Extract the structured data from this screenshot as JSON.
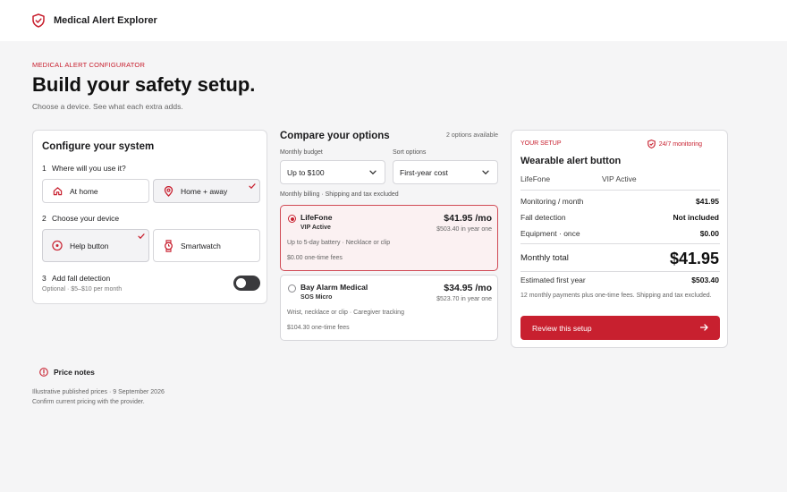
{
  "header": {
    "app_title": "Medical Alert Explorer",
    "logo_icon": "shield-check-icon"
  },
  "hero": {
    "eyebrow": "MEDICAL ALERT CONFIGURATOR",
    "title": "Build your safety setup.",
    "subtitle": "Choose a device. See what each extra adds."
  },
  "config": {
    "title": "Configure your system",
    "step1": {
      "num": "1",
      "question": "Where will you use it?",
      "options": [
        {
          "label": "At home",
          "icon": "home-icon",
          "selected": false
        },
        {
          "label": "Home + away",
          "icon": "location-pin-icon",
          "selected": true
        }
      ]
    },
    "step2": {
      "num": "2",
      "question": "Choose your device",
      "options": [
        {
          "label": "Help button",
          "icon": "help-button-icon",
          "selected": true
        },
        {
          "label": "Smartwatch",
          "icon": "watch-icon",
          "selected": false
        }
      ]
    },
    "step3": {
      "num": "3",
      "question": "Add fall detection",
      "hint": "Optional · $5–$10 per month",
      "enabled": false
    }
  },
  "compare": {
    "title": "Compare your options",
    "available": "2 options available",
    "budget_label": "Monthly budget",
    "budget_value": "Up to $100",
    "sort_label": "Sort options",
    "sort_value": "First-year cost",
    "billing_note": "Monthly billing · Shipping and tax excluded",
    "plans": [
      {
        "name": "LifeFone",
        "model": "VIP Active",
        "price": "$41.95 /mo",
        "year": "$503.40 in year one",
        "desc": "Up to 5-day battery · Necklace or clip",
        "fees": "$0.00 one-time fees",
        "selected": true
      },
      {
        "name": "Bay Alarm Medical",
        "model": "SOS Micro",
        "price": "$34.95 /mo",
        "year": "$523.70 in year one",
        "desc": "Wrist, necklace or clip · Caregiver tracking",
        "fees": "$104.30 one-time fees",
        "selected": false
      }
    ]
  },
  "summary": {
    "eyebrow": "YOUR SETUP",
    "badge": "24/7 monitoring",
    "title": "Wearable alert button",
    "brand": "LifeFone",
    "model": "VIP Active",
    "rows": [
      {
        "label": "Monitoring / month",
        "value": "$41.95"
      },
      {
        "label": "Fall detection",
        "value": "Not included"
      },
      {
        "label": "Equipment · once",
        "value": "$0.00"
      }
    ],
    "total_label": "Monthly total",
    "total_value": "$41.95",
    "first_year_label": "Estimated first year",
    "first_year_value": "$503.40",
    "fine_print": "12 monthly payments plus one-time fees. Shipping and tax excluded.",
    "cta": "Review this setup"
  },
  "notes": {
    "title": "Price notes",
    "line1": "Illustrative published prices · 9 September 2026",
    "line2": "Confirm current pricing with the provider."
  },
  "colors": {
    "accent": "#c8202f",
    "selected_plan_bg": "#fbf1f2",
    "toggle_off": "#3a3a3d"
  }
}
